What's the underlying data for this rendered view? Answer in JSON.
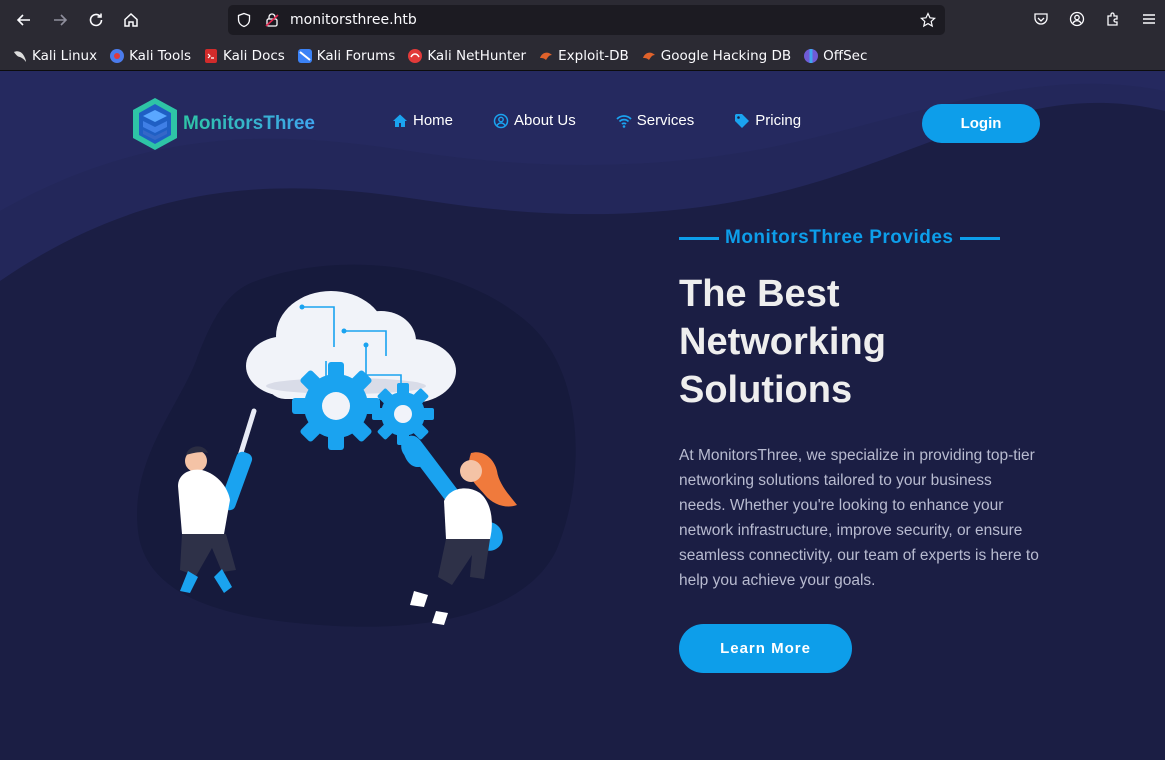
{
  "browser": {
    "url": "monitorsthree.htb",
    "bookmarks": [
      {
        "label": "Kali Linux",
        "icon": "kali-dragon-icon",
        "color": "#cccccc"
      },
      {
        "label": "Kali Tools",
        "icon": "kali-tools-icon",
        "color": "#4b7bec"
      },
      {
        "label": "Kali Docs",
        "icon": "kali-docs-icon",
        "color": "#d12b2b"
      },
      {
        "label": "Kali Forums",
        "icon": "kali-forums-icon",
        "color": "#3b82f6"
      },
      {
        "label": "Kali NetHunter",
        "icon": "nethunter-icon",
        "color": "#e23a3a"
      },
      {
        "label": "Exploit-DB",
        "icon": "exploit-db-icon",
        "color": "#e0622b"
      },
      {
        "label": "Google Hacking DB",
        "icon": "ghdb-icon",
        "color": "#e0622b"
      },
      {
        "label": "OffSec",
        "icon": "offsec-icon",
        "color": "#6f5bd6"
      }
    ]
  },
  "site": {
    "brand": "MonitorsThree",
    "nav": [
      {
        "label": "Home",
        "icon": "home-icon"
      },
      {
        "label": "About Us",
        "icon": "user-circle-icon"
      },
      {
        "label": "Services",
        "icon": "wifi-icon"
      },
      {
        "label": "Pricing",
        "icon": "tag-icon"
      }
    ],
    "login_label": "Login",
    "hero": {
      "eyebrow": "MonitorsThree Provides",
      "headline": "The Best Networking Solutions",
      "paragraph": "At MonitorsThree, we specialize in providing top-tier networking solutions tailored to your business needs. Whether you're looking to enhance your network infrastructure, improve security, or ensure seamless connectivity, our team of experts is here to help you achieve your goals.",
      "cta_label": "Learn More"
    }
  },
  "colors": {
    "accent": "#0d9eea",
    "background": "#1b1e44",
    "brand_gradient_start": "#2ec4a6",
    "brand_gradient_end": "#3fa5ef"
  }
}
